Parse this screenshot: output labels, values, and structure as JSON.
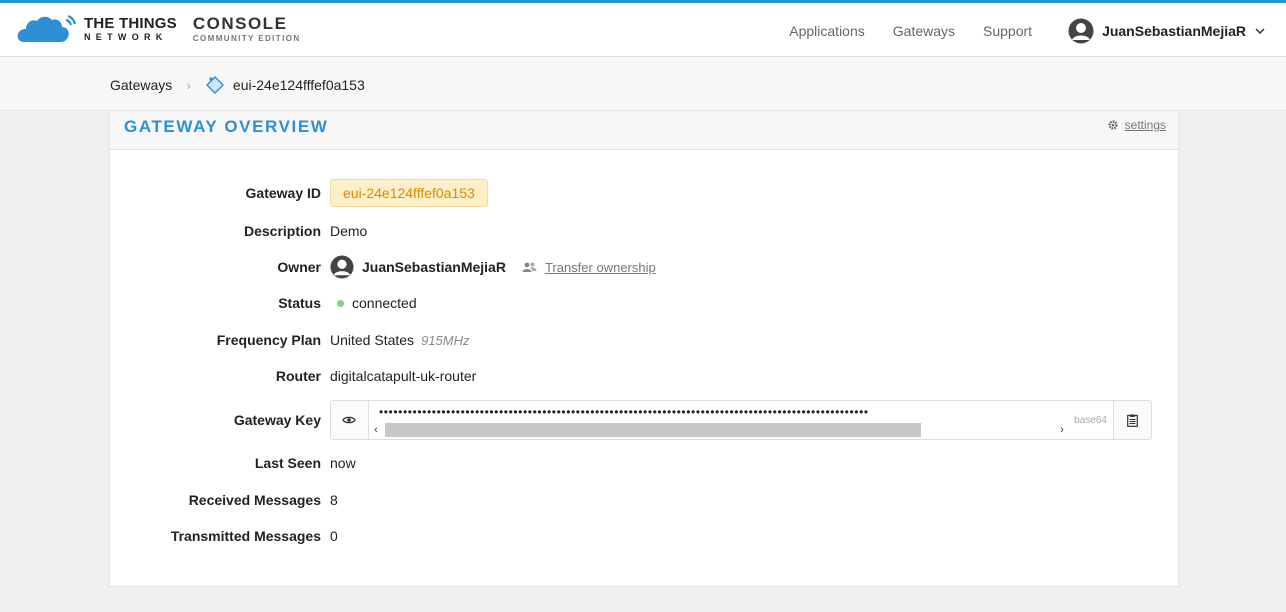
{
  "brand": {
    "line1": "THE THINGS",
    "line2": "NETWORK",
    "console": "CONSOLE",
    "edition": "COMMUNITY EDITION"
  },
  "nav": {
    "applications": "Applications",
    "gateways": "Gateways",
    "support": "Support",
    "user": "JuanSebastianMejiaR"
  },
  "breadcrumb": {
    "parent": "Gateways",
    "current": "eui-24e124fffef0a153"
  },
  "panel": {
    "title": "GATEWAY OVERVIEW",
    "settings": "settings"
  },
  "fields": {
    "gateway_id": {
      "label": "Gateway ID",
      "value": "eui-24e124fffef0a153"
    },
    "description": {
      "label": "Description",
      "value": "Demo"
    },
    "owner": {
      "label": "Owner",
      "value": "JuanSebastianMejiaR",
      "transfer": "Transfer ownership"
    },
    "status": {
      "label": "Status",
      "value": "connected",
      "color": "#7ed67e"
    },
    "frequency_plan": {
      "label": "Frequency Plan",
      "value": "United States",
      "mhz": "915MHz"
    },
    "router": {
      "label": "Router",
      "value": "digitalcatapult-uk-router"
    },
    "gateway_key": {
      "label": "Gateway Key",
      "masked": "••••••••••••••••••••••••••••••••••••••••••••••••••••••••••••••••••••••••••••••••••••••••••••••••••••••",
      "format": "base64"
    },
    "last_seen": {
      "label": "Last Seen",
      "value": "now"
    },
    "received": {
      "label": "Received Messages",
      "value": "8"
    },
    "transmitted": {
      "label": "Transmitted Messages",
      "value": "0"
    }
  },
  "colors": {
    "accent": "#2d8fd5",
    "id_badge_bg": "#fdf0c8",
    "id_badge_text": "#d88a00"
  }
}
